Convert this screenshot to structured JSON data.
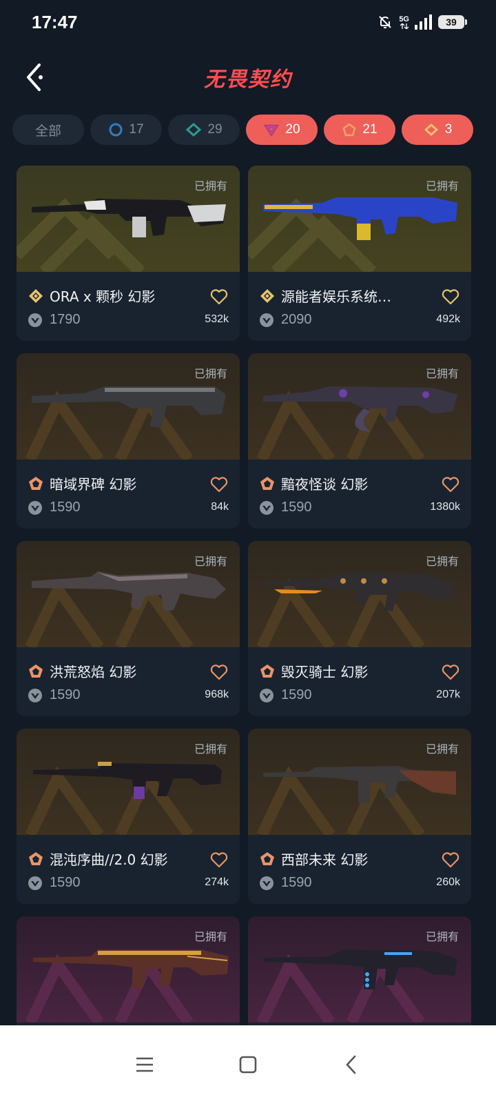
{
  "status_bar": {
    "time": "17:47",
    "network": "5G",
    "battery": "39"
  },
  "header": {
    "title": "无畏契约"
  },
  "filters": [
    {
      "label": "全部",
      "icon": "none",
      "active": false
    },
    {
      "label": "17",
      "icon": "circle-tier-icon",
      "active": false
    },
    {
      "label": "29",
      "icon": "diamond-tier-icon",
      "active": false
    },
    {
      "label": "20",
      "icon": "triangle-tier-icon",
      "active": true
    },
    {
      "label": "21",
      "icon": "pentagon-tier-icon",
      "active": true
    },
    {
      "label": "3",
      "icon": "gem-tier-icon",
      "active": true
    }
  ],
  "owned_label": "已拥有",
  "skins": [
    {
      "name": "ORA x 颗秒 幻影",
      "tier": "gem",
      "price": "1790",
      "likes": "532k",
      "bg": "gold"
    },
    {
      "name": "源能者娱乐系统…",
      "tier": "gem",
      "price": "2090",
      "likes": "492k",
      "bg": "gold"
    },
    {
      "name": "暗域界碑 幻影",
      "tier": "pentagon",
      "price": "1590",
      "likes": "84k",
      "bg": "brown"
    },
    {
      "name": "黯夜怪谈 幻影",
      "tier": "pentagon",
      "price": "1590",
      "likes": "1380k",
      "bg": "brown"
    },
    {
      "name": "洪荒怒焰 幻影",
      "tier": "pentagon",
      "price": "1590",
      "likes": "968k",
      "bg": "brown"
    },
    {
      "name": "毁灭骑士 幻影",
      "tier": "pentagon",
      "price": "1590",
      "likes": "207k",
      "bg": "brown"
    },
    {
      "name": "混沌序曲//2.0 幻影",
      "tier": "pentagon",
      "price": "1590",
      "likes": "274k",
      "bg": "brown"
    },
    {
      "name": "西部未来 幻影",
      "tier": "pentagon",
      "price": "1590",
      "likes": "260k",
      "bg": "brown"
    },
    {
      "name": "",
      "tier": "",
      "price": "",
      "likes": "",
      "bg": "purple"
    },
    {
      "name": "",
      "tier": "",
      "price": "",
      "likes": "",
      "bg": "purple"
    }
  ],
  "colors": {
    "accent": "#ef5f5a",
    "gem_tier": "#e9c46a",
    "pentagon_tier": "#e8956a",
    "title": "#ff4e50"
  }
}
